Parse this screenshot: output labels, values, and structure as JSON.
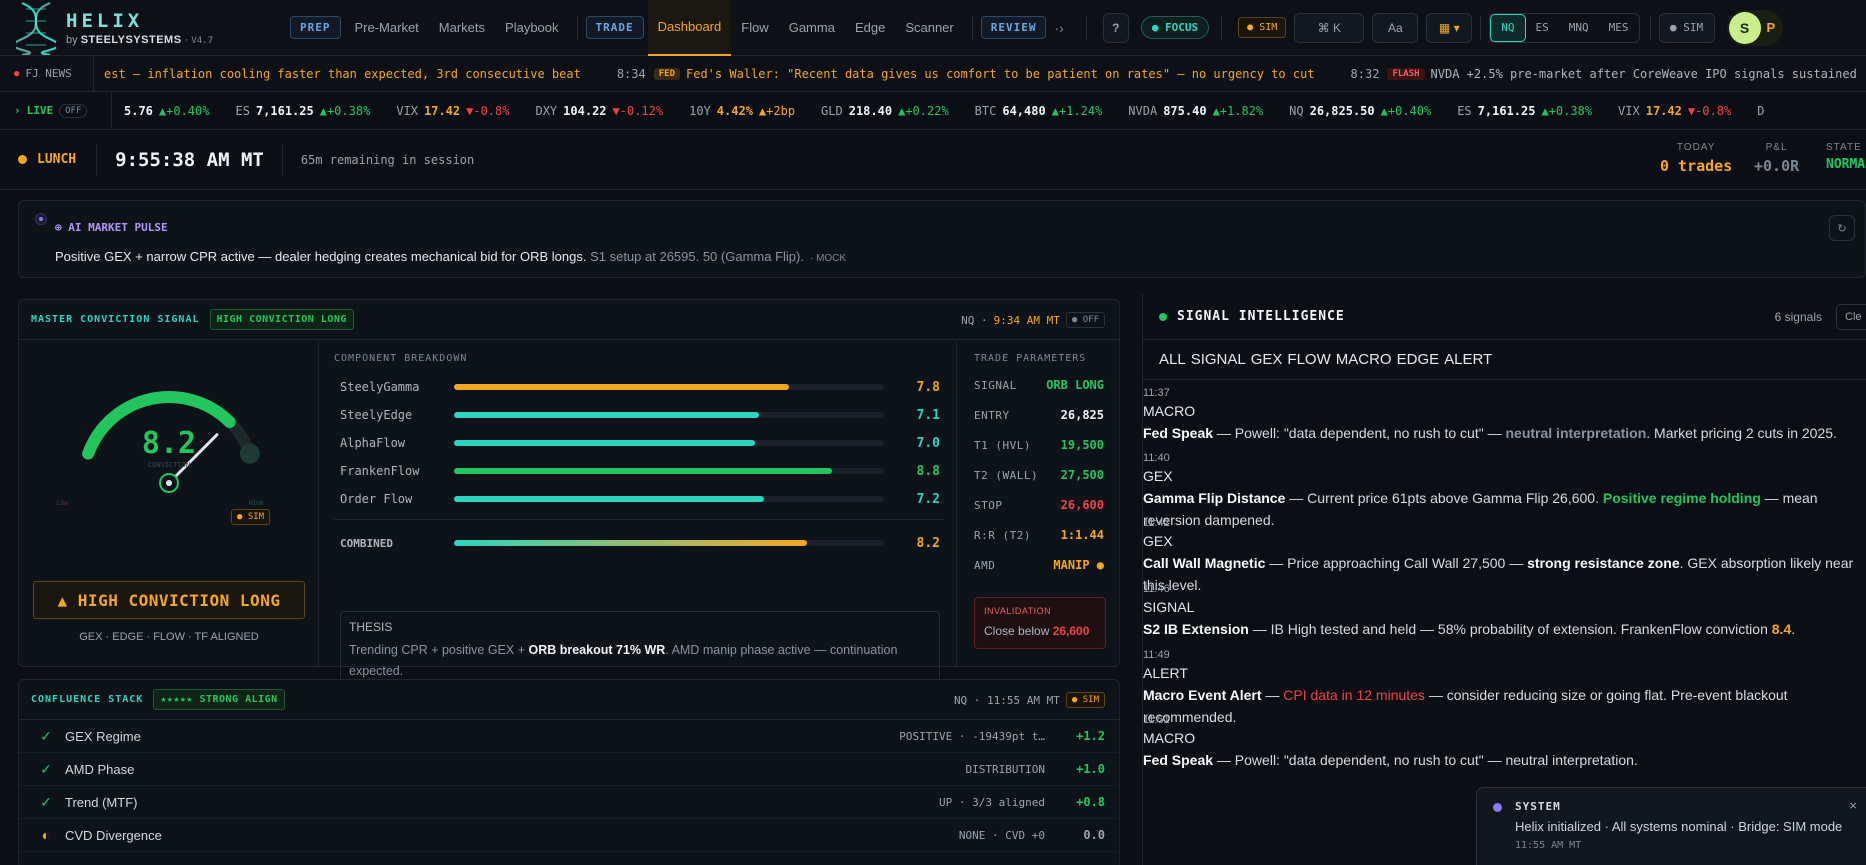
{
  "brand": {
    "name": "HELIX",
    "by": "by",
    "company": "STEELYSYSTEMS",
    "version": "V4.7"
  },
  "nav": {
    "prep_label": "PREP",
    "prep_links": [
      "Pre-Market",
      "Markets",
      "Playbook"
    ],
    "trade_label": "TRADE",
    "trade_links": [
      "Dashboard",
      "Flow",
      "Gamma",
      "Edge",
      "Scanner"
    ],
    "review_label": "REVIEW",
    "more": "·›",
    "help": "?",
    "focus": "● FOCUS",
    "sim": "● SIM",
    "cmdk": "⌘ K",
    "font": "Aa",
    "apps": "▦ ▾",
    "markets": [
      "NQ",
      "ES",
      "MNQ",
      "MES"
    ],
    "sim_status": "● SIM",
    "avatar": "S",
    "avatar_extra": "P"
  },
  "news": {
    "label": "FJ NEWS",
    "items": [
      {
        "time": "",
        "tag": "",
        "text": "est — inflation cooling faster than expected, 3rd consecutive beat"
      },
      {
        "time": "8:34",
        "tag": "FED",
        "text": "Fed's Waller: \"Recent data gives us comfort to be patient on rates\" — no urgency to cut"
      },
      {
        "time": "8:32",
        "tag": "FLASH",
        "text": "NVDA +2.5% pre-market after CoreWeave IPO signals sustained"
      }
    ]
  },
  "ticker": {
    "label": "LIVE",
    "toggle": "OFF",
    "items": [
      {
        "s": "",
        "p": "5.76",
        "c": "▲+0.40%",
        "dir": "up"
      },
      {
        "s": "ES",
        "p": "7,161.25",
        "c": "▲+0.38%",
        "dir": "up"
      },
      {
        "s": "VIX",
        "p": "17.42",
        "c": "▼-0.8%",
        "dir": "down"
      },
      {
        "s": "DXY",
        "p": "104.22",
        "c": "▼-0.12%",
        "dir": "down"
      },
      {
        "s": "10Y",
        "p": "4.42%",
        "c": "▲+2bp",
        "dir": "warn"
      },
      {
        "s": "GLD",
        "p": "218.40",
        "c": "▲+0.22%",
        "dir": "up"
      },
      {
        "s": "BTC",
        "p": "64,480",
        "c": "▲+1.24%",
        "dir": "up"
      },
      {
        "s": "NVDA",
        "p": "875.40",
        "c": "▲+1.82%",
        "dir": "up"
      },
      {
        "s": "NQ",
        "p": "26,825.50",
        "c": "▲+0.40%",
        "dir": "up"
      },
      {
        "s": "ES",
        "p": "7,161.25",
        "c": "▲+0.38%",
        "dir": "up"
      },
      {
        "s": "VIX",
        "p": "17.42",
        "c": "▼-0.8%",
        "dir": "down"
      },
      {
        "s": "D",
        "p": "",
        "c": "",
        "dir": "up"
      }
    ]
  },
  "session": {
    "phase": "LUNCH",
    "clock": "9:55:38 AM MT",
    "remaining": "65m remaining in session",
    "today_label": "TODAY",
    "today_value": "0 trades",
    "pnl_label": "P&L",
    "pnl_value": "+0.0R",
    "state_label": "STATE",
    "state_value": "NORMAL"
  },
  "pulse": {
    "title": "⊕ AI MARKET PULSE",
    "main": "Positive GEX + narrow CPR active — dealer hedging creates mechanical bid for ORB longs.",
    "detail": "S1 setup at 26595. 50 (Gamma Flip).",
    "mock": "· MOCK",
    "refresh": "↻"
  },
  "master": {
    "title": "MASTER CONVICTION SIGNAL",
    "badge": "HIGH CONVICTION LONG",
    "symbol": "NQ ·",
    "time": "9:34 AM MT",
    "toggle": "● OFF",
    "score": "8.2",
    "score_value": 8.2,
    "score_max": 10,
    "score_caption": "CONVICTION",
    "low": "LOW",
    "high": "HIGH",
    "sim": "● SIM",
    "verdict": "▲ HIGH CONVICTION LONG",
    "aligned": "GEX · EDGE · FLOW · TF ALIGNED",
    "breakdown_title": "COMPONENT BREAKDOWN",
    "components": [
      {
        "name": "SteelyGamma",
        "value": "7.8",
        "num": 7.8,
        "color": "#f5a623"
      },
      {
        "name": "SteelyEdge",
        "value": "7.1",
        "num": 7.1,
        "color": "#2dd4bf"
      },
      {
        "name": "AlphaFlow",
        "value": "7.0",
        "num": 7.0,
        "color": "#2dd4bf"
      },
      {
        "name": "FrankenFlow",
        "value": "8.8",
        "num": 8.8,
        "color": "#22c55e"
      },
      {
        "name": "Order Flow",
        "value": "7.2",
        "num": 7.2,
        "color": "#2dd4bf"
      }
    ],
    "combined_label": "COMBINED",
    "combined_value": "8.2",
    "combined_num": 8.2,
    "thesis_label": "THESIS",
    "thesis_pre": "Trending CPR + positive GEX + ",
    "thesis_bold": "ORB breakout 71% WR",
    "thesis_post": ". AMD manip phase active — continuation expected.",
    "params_title": "TRADE PARAMETERS",
    "params": [
      {
        "k": "SIGNAL",
        "v": "ORB LONG",
        "c": "green"
      },
      {
        "k": "ENTRY",
        "v": "26,825",
        "c": "white"
      },
      {
        "k": "T1 (HVL)",
        "v": "19,500",
        "c": "green"
      },
      {
        "k": "T2 (WALL)",
        "v": "27,500",
        "c": "green"
      },
      {
        "k": "STOP",
        "v": "26,600",
        "c": "red"
      },
      {
        "k": "R:R (T2)",
        "v": "1:1.44",
        "c": "amber"
      },
      {
        "k": "AMD",
        "v": "MANIP ●",
        "c": "amber"
      }
    ],
    "invalidation_label": "INVALIDATION",
    "invalidation_text": "Close below ",
    "invalidation_value": "26,600"
  },
  "confluence": {
    "title": "CONFLUENCE STACK",
    "badge": "★★★★★ STRONG ALIGN",
    "symbol": "NQ · 11:55 AM MT",
    "sim": "● SIM",
    "rows": [
      {
        "icon": "✓",
        "name": "GEX Regime",
        "detail": "POSITIVE · -19439pt t…",
        "score": "+1.2",
        "state": "ok"
      },
      {
        "icon": "✓",
        "name": "AMD Phase",
        "detail": "DISTRIBUTION",
        "score": "+1.0",
        "state": "ok"
      },
      {
        "icon": "✓",
        "name": "Trend (MTF)",
        "detail": "UP · 3/3 aligned",
        "score": "+0.8",
        "state": "ok"
      },
      {
        "icon": "◐",
        "name": "CVD Divergence",
        "detail": "NONE · CVD +0",
        "score": "0.0",
        "state": "neutral"
      }
    ]
  },
  "signals": {
    "title": "SIGNAL INTELLIGENCE",
    "count": "6 signals",
    "clear": "Cle",
    "filters": [
      "ALL",
      "SIGNAL",
      "GEX",
      "FLOW",
      "MACRO",
      "EDGE",
      "ALERT"
    ],
    "events": [
      {
        "time": "11:37",
        "cat": "MACRO",
        "title": "Fed Speak",
        "a": " — Powell: \"data dependent, no rush to cut\" — ",
        "hl": "neutral interpretation",
        "hlc": "hlm",
        "b": ". Market pricing 2 cuts in 2025."
      },
      {
        "time": "11:40",
        "cat": "GEX",
        "title": "Gamma Flip Distance",
        "a": " — Current price 61pts above Gamma Flip 26,600. ",
        "hl": "Positive regime holding",
        "hlc": "hlg",
        "b": " — mean reversion dampened."
      },
      {
        "time": "11:42",
        "cat": "GEX",
        "title": "Call Wall Magnetic",
        "a": " — Price approaching Call Wall 27,500 — ",
        "hl": "strong resistance zone",
        "hlc": "bold",
        "b": ". GEX absorption likely near this level."
      },
      {
        "time": "11:46",
        "cat": "SIGNAL",
        "title": "S2 IB Extension",
        "a": " — IB High tested and held — 58% probability of extension. FrankenFlow conviction ",
        "hl": "8.4",
        "hlc": "hla",
        "b": "."
      },
      {
        "time": "11:49",
        "cat": "ALERT",
        "title": "Macro Event Alert",
        "a": " — ",
        "hl": "CPI data in 12 minutes",
        "hlc": "hlr",
        "b": " — consider reducing size or going flat. Pre-event blackout recommended."
      },
      {
        "time": "11:51",
        "cat": "MACRO",
        "title": "Fed Speak",
        "a": " — Powell: \"data dependent, no rush to cut\" — neutral interpretation.",
        "hl": "",
        "hlc": "",
        "b": ""
      }
    ]
  },
  "toast": {
    "title": "SYSTEM",
    "message": "Helix initialized · All systems nominal · Bridge: SIM mode",
    "time": "11:55 AM MT",
    "close": "×"
  }
}
